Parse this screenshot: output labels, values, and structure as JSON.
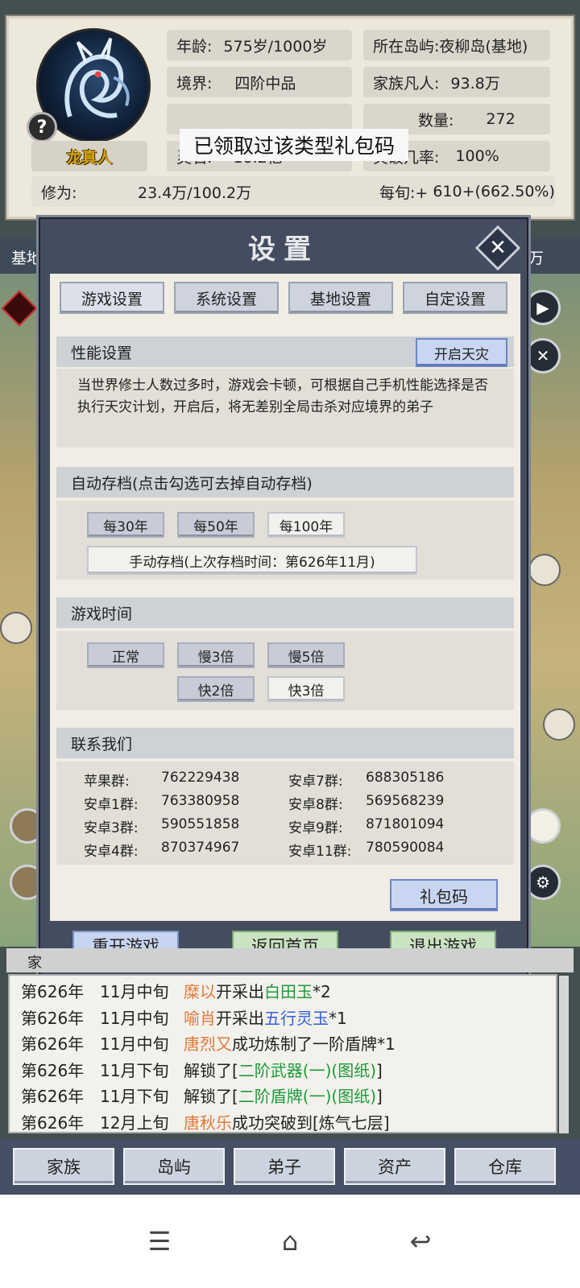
{
  "status": {
    "name": "龙真人",
    "help_icon": "?",
    "age_label": "年龄:",
    "age_value": "575岁/1000岁",
    "realm_label": "境界:",
    "realm_value": "四阶中品",
    "spirit_stone_label": "灵石:",
    "spirit_stone_value": "10.2亿",
    "island_label": "所在岛屿:",
    "island_value": "夜柳岛(基地)",
    "mortals_label": "家族凡人:",
    "mortals_value": "93.8万",
    "disciples_label": "数量:",
    "disciples_value": "272",
    "breakthrough_label": "突破几率:",
    "breakthrough_value": "100%",
    "cultivation_label": "修为:",
    "cultivation_value": "23.4万/100.2万",
    "per_period_label": "每旬:+",
    "per_period_value": "610+(662.50%)",
    "tooltip": "已领取过该类型礼包码"
  },
  "map": {
    "bar_left": "基地",
    "bar_right": "万"
  },
  "dialog": {
    "title": "设置",
    "close_icon": "✕",
    "tabs": [
      "游戏设置",
      "系统设置",
      "基地设置",
      "自定设置"
    ],
    "performance": {
      "title": "性能设置",
      "button": "开启天灾",
      "description": "当世界修士人数过多时，游戏会卡顿，可根据自己手机性能选择是否执行天灾计划，开启后，将无差别全局击杀对应境界的弟子"
    },
    "autosave": {
      "title": "自动存档(点击勾选可去掉自动存档)",
      "options": [
        "每30年",
        "每50年",
        "每100年"
      ],
      "manual": "手动存档(上次存档时间：第626年11月)"
    },
    "game_time": {
      "title": "游戏时间",
      "options": [
        "正常",
        "慢3倍",
        "慢5倍",
        "快2倍",
        "快3倍"
      ]
    },
    "contact": {
      "title": "联系我们",
      "groups": [
        {
          "name": "苹果群:",
          "number": "762229438"
        },
        {
          "name": "安卓7群:",
          "number": "688305186"
        },
        {
          "name": "安卓1群:",
          "number": "763380958"
        },
        {
          "name": "安卓8群:",
          "number": "569568239"
        },
        {
          "name": "安卓3群:",
          "number": "590551858"
        },
        {
          "name": "安卓9群:",
          "number": "871801094"
        },
        {
          "name": "安卓4群:",
          "number": "870374967"
        },
        {
          "name": "安卓11群:",
          "number": "780590084"
        }
      ]
    },
    "gift_code": "礼包码",
    "footer": {
      "restart": "重开游戏",
      "home": "返回首页",
      "exit": "退出游戏"
    }
  },
  "log": {
    "tab_label": "家",
    "lines": [
      {
        "year": "第626年",
        "period": "11月中旬",
        "who": "糜以",
        "action": "开采出",
        "item": "白田玉",
        "suffix": "*2",
        "item_color": "green"
      },
      {
        "year": "第626年",
        "period": "11月中旬",
        "who": "喻肖",
        "action": "开采出",
        "item": "五行灵玉",
        "suffix": "*1",
        "item_color": "blue"
      },
      {
        "year": "第626年",
        "period": "11月中旬",
        "who": "唐烈又",
        "action": "成功炼制了一阶盾牌*1",
        "item": "",
        "suffix": "",
        "item_color": ""
      },
      {
        "year": "第626年",
        "period": "11月下旬",
        "who": "",
        "action": "解锁了[",
        "item": "二阶武器(一)(图纸)",
        "suffix": "]",
        "item_color": "green"
      },
      {
        "year": "第626年",
        "period": "11月下旬",
        "who": "",
        "action": "解锁了[",
        "item": "二阶盾牌(一)(图纸)",
        "suffix": "]",
        "item_color": "green"
      },
      {
        "year": "第626年",
        "period": "12月上旬",
        "who": "唐秋乐",
        "action": "成功突破到[炼气七层]",
        "item": "",
        "suffix": "",
        "item_color": ""
      }
    ]
  },
  "nav": [
    "家族",
    "岛屿",
    "弟子",
    "资产",
    "仓库"
  ],
  "system_bar": {
    "menu_icon": "☰",
    "home_icon": "⌂",
    "back_icon": "↩"
  }
}
